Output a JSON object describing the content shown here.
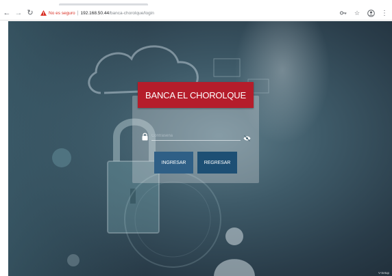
{
  "browser": {
    "security_label": "No es seguro",
    "url_host": "192.168.50.44",
    "url_path": "/banca-chorolque/login",
    "separator": "|"
  },
  "page": {
    "brand_title": "BANCA EL CHOROLQUE",
    "password": {
      "placeholder": "Contraseña",
      "value": ""
    },
    "buttons": {
      "ingresar": "INGRESAR",
      "regresar": "REGRESAR"
    },
    "corner_text": "V-Setup"
  },
  "colors": {
    "brand_red": "#b51d2b",
    "button_blue": "#2f5f86",
    "button_dark_blue": "#1d4f74",
    "insecure_red": "#d93025"
  },
  "icons": {
    "back": "arrow-left",
    "forward": "arrow-right",
    "reload": "refresh",
    "warning": "warning-triangle",
    "key": "key",
    "star": "star",
    "account": "account-circle",
    "menu": "vertical-ellipsis",
    "lock": "padlock",
    "eye": "eye-slash"
  }
}
